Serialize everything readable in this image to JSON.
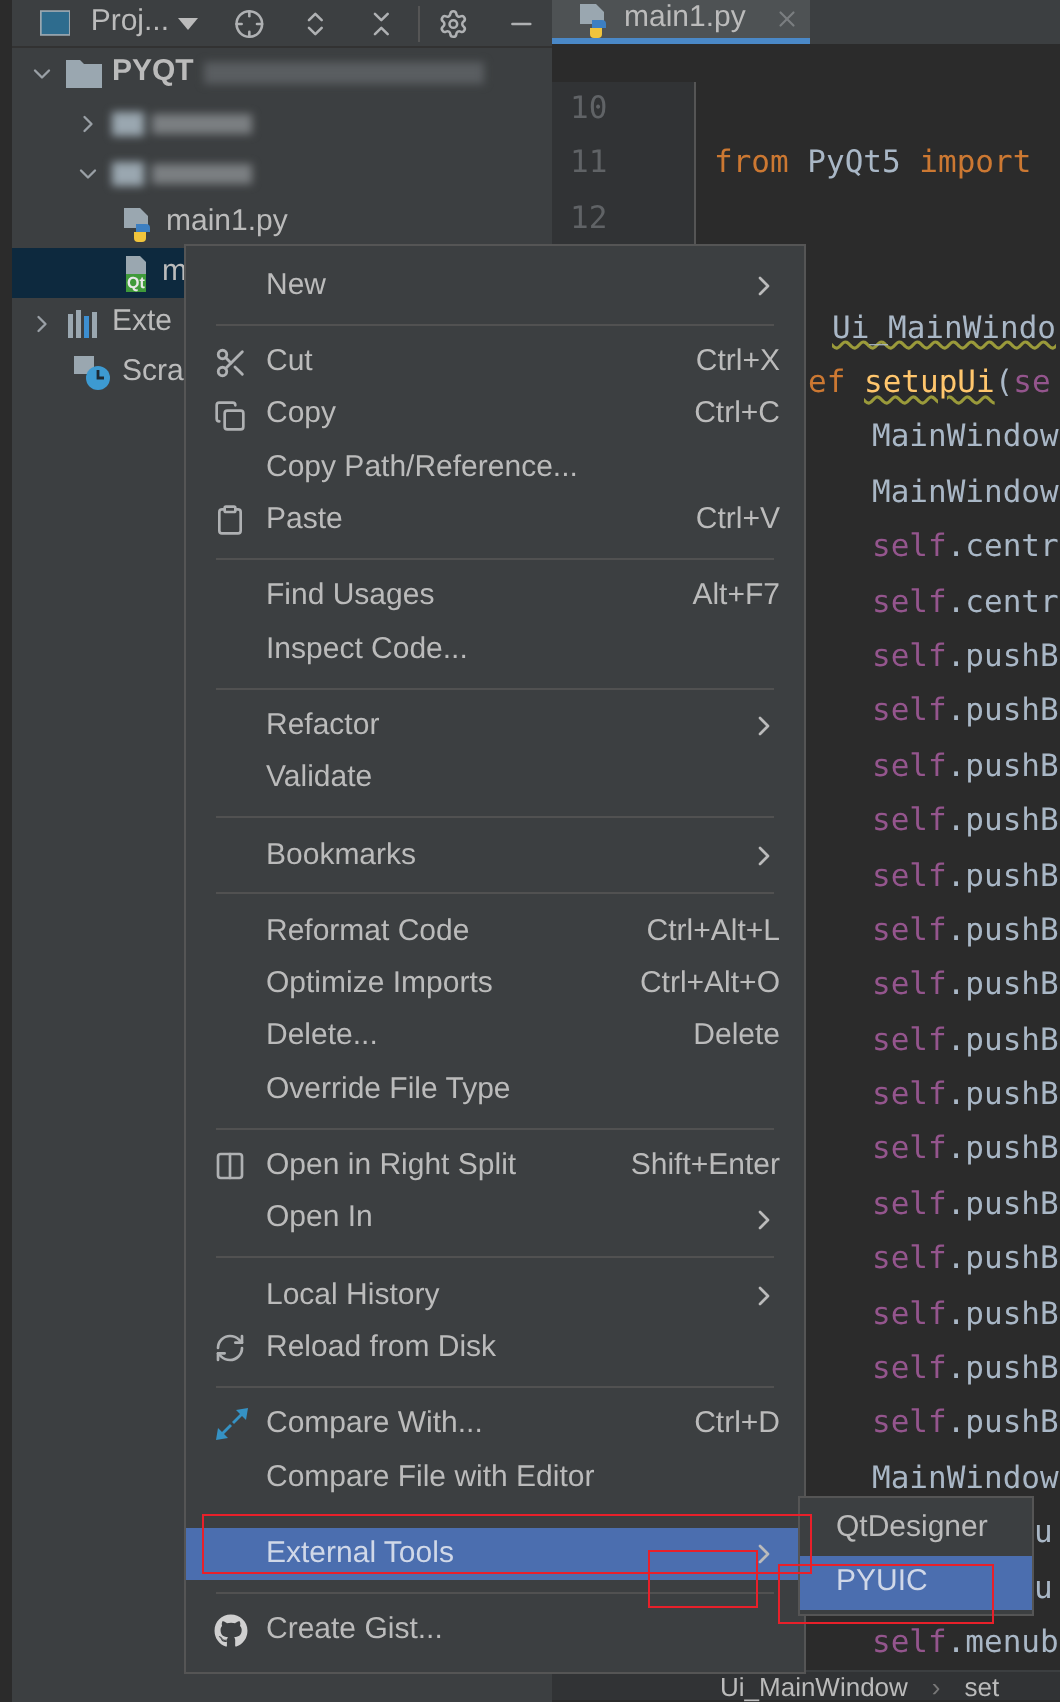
{
  "project_panel": {
    "title": "Proj...",
    "tree": [
      {
        "kind": "project",
        "label": "PYQT",
        "expanded": true,
        "selected": false,
        "children": [
          {
            "kind": "blurred",
            "expanded": false,
            "selected": false
          },
          {
            "kind": "blurred",
            "expanded": true,
            "selected": false,
            "children": [
              {
                "kind": "python",
                "label": "main1.py",
                "selected": false
              },
              {
                "kind": "qt",
                "label": "m",
                "badge": "Qt",
                "selected": true
              }
            ]
          }
        ]
      },
      {
        "kind": "library",
        "label": "Exte",
        "expanded": false,
        "selected": false
      },
      {
        "kind": "scratch",
        "label": "Scra",
        "selected": false
      }
    ]
  },
  "editor": {
    "tab": {
      "label": "main1.py",
      "selected": true
    },
    "gutter_lines": [
      {
        "number": "10"
      },
      {
        "number": "11",
        "tokens": [
          {
            "text": "from ",
            "kind": "keyword"
          },
          {
            "text": "PyQt5 ",
            "kind": "text"
          },
          {
            "text": "import",
            "kind": "keyword"
          }
        ]
      },
      {
        "number": "12"
      }
    ],
    "lines": [
      {
        "kind": "class",
        "tokens": [
          {
            "text": "Ui_MainWindo",
            "kind": "text",
            "underlined": true
          }
        ]
      },
      {
        "kind": "def",
        "tokens": [
          {
            "text": "ef ",
            "kind": "keyword"
          },
          {
            "text": "setupUi",
            "kind": "func",
            "underlined": true
          },
          {
            "text": "(",
            "kind": "text"
          },
          {
            "text": "se",
            "kind": "self"
          }
        ]
      },
      {
        "kind": "body",
        "tokens": [
          {
            "text": "MainWindow",
            "kind": "text"
          }
        ]
      },
      {
        "kind": "body",
        "tokens": [
          {
            "text": "MainWindow",
            "kind": "text"
          }
        ]
      },
      {
        "kind": "body",
        "tokens": [
          {
            "text": "self",
            "kind": "self"
          },
          {
            "text": ".centr",
            "kind": "text"
          }
        ]
      },
      {
        "kind": "body",
        "tokens": [
          {
            "text": "self",
            "kind": "self"
          },
          {
            "text": ".centr",
            "kind": "text"
          }
        ]
      },
      {
        "kind": "body",
        "tokens": [
          {
            "text": "self",
            "kind": "self"
          },
          {
            "text": ".pushB",
            "kind": "text"
          }
        ]
      },
      {
        "kind": "body",
        "tokens": [
          {
            "text": "self",
            "kind": "self"
          },
          {
            "text": ".pushB",
            "kind": "text"
          }
        ]
      },
      {
        "kind": "body",
        "tokens": [
          {
            "text": "self",
            "kind": "self"
          },
          {
            "text": ".pushB",
            "kind": "text"
          }
        ]
      },
      {
        "kind": "body",
        "tokens": [
          {
            "text": "self",
            "kind": "self"
          },
          {
            "text": ".pushB",
            "kind": "text"
          }
        ]
      },
      {
        "kind": "body",
        "tokens": [
          {
            "text": "self",
            "kind": "self"
          },
          {
            "text": ".pushB",
            "kind": "text"
          }
        ]
      },
      {
        "kind": "body",
        "tokens": [
          {
            "text": "self",
            "kind": "self"
          },
          {
            "text": ".pushB",
            "kind": "text"
          }
        ]
      },
      {
        "kind": "body",
        "tokens": [
          {
            "text": "self",
            "kind": "self"
          },
          {
            "text": ".pushB",
            "kind": "text"
          }
        ]
      },
      {
        "kind": "body",
        "tokens": [
          {
            "text": "self",
            "kind": "self"
          },
          {
            "text": ".pushB",
            "kind": "text"
          }
        ]
      },
      {
        "kind": "body",
        "tokens": [
          {
            "text": "self",
            "kind": "self"
          },
          {
            "text": ".pushB",
            "kind": "text"
          }
        ]
      },
      {
        "kind": "body",
        "tokens": [
          {
            "text": "self",
            "kind": "self"
          },
          {
            "text": ".pushB",
            "kind": "text"
          }
        ]
      },
      {
        "kind": "body",
        "tokens": [
          {
            "text": "self",
            "kind": "self"
          },
          {
            "text": ".pushB",
            "kind": "text"
          }
        ]
      },
      {
        "kind": "body",
        "tokens": [
          {
            "text": "self",
            "kind": "self"
          },
          {
            "text": ".pushB",
            "kind": "text"
          }
        ]
      },
      {
        "kind": "body",
        "tokens": [
          {
            "text": "self",
            "kind": "self"
          },
          {
            "text": ".pushB",
            "kind": "text"
          }
        ]
      },
      {
        "kind": "body",
        "tokens": [
          {
            "text": "self",
            "kind": "self"
          },
          {
            "text": ".pushB",
            "kind": "text"
          }
        ]
      },
      {
        "kind": "body",
        "tokens": [
          {
            "text": "self",
            "kind": "self"
          },
          {
            "text": ".pushB",
            "kind": "text"
          }
        ]
      },
      {
        "kind": "body",
        "tokens": [
          {
            "text": "MainWindow",
            "kind": "text"
          }
        ]
      },
      {
        "kind": "tail",
        "tokens": [
          {
            "text": "u",
            "kind": "text"
          }
        ]
      },
      {
        "kind": "tail",
        "tokens": [
          {
            "text": "u",
            "kind": "text"
          }
        ]
      },
      {
        "kind": "body",
        "tokens": [
          {
            "text": "self",
            "kind": "self"
          },
          {
            "text": ".menub",
            "kind": "text"
          }
        ]
      }
    ],
    "breadcrumb": {
      "items": [
        "Ui_MainWindow",
        "set"
      ],
      "separator": "›"
    }
  },
  "context_menu": {
    "items": [
      {
        "kind": "item",
        "label": "New",
        "submenu": true,
        "selected": false
      },
      {
        "kind": "separator"
      },
      {
        "kind": "item",
        "label": "Cut",
        "shortcut": "Ctrl+X",
        "selected": false
      },
      {
        "kind": "item",
        "label": "Copy",
        "shortcut": "Ctrl+C",
        "selected": false
      },
      {
        "kind": "item",
        "label": "Copy Path/Reference...",
        "selected": false
      },
      {
        "kind": "item",
        "label": "Paste",
        "shortcut": "Ctrl+V",
        "selected": false
      },
      {
        "kind": "separator"
      },
      {
        "kind": "item",
        "label": "Find Usages",
        "shortcut": "Alt+F7",
        "selected": false
      },
      {
        "kind": "item",
        "label": "Inspect Code...",
        "selected": false
      },
      {
        "kind": "separator"
      },
      {
        "kind": "item",
        "label": "Refactor",
        "submenu": true,
        "selected": false
      },
      {
        "kind": "item",
        "label": "Validate",
        "selected": false
      },
      {
        "kind": "separator"
      },
      {
        "kind": "item",
        "label": "Bookmarks",
        "submenu": true,
        "selected": false
      },
      {
        "kind": "separator"
      },
      {
        "kind": "item",
        "label": "Reformat Code",
        "shortcut": "Ctrl+Alt+L",
        "selected": false
      },
      {
        "kind": "item",
        "label": "Optimize Imports",
        "shortcut": "Ctrl+Alt+O",
        "selected": false
      },
      {
        "kind": "item",
        "label": "Delete...",
        "shortcut": "Delete",
        "selected": false
      },
      {
        "kind": "item",
        "label": "Override File Type",
        "selected": false
      },
      {
        "kind": "separator"
      },
      {
        "kind": "item",
        "label": "Open in Right Split",
        "shortcut": "Shift+Enter",
        "selected": false
      },
      {
        "kind": "item",
        "label": "Open In",
        "submenu": true,
        "selected": false
      },
      {
        "kind": "separator"
      },
      {
        "kind": "item",
        "label": "Local History",
        "submenu": true,
        "selected": false
      },
      {
        "kind": "item",
        "label": "Reload from Disk",
        "selected": false
      },
      {
        "kind": "separator"
      },
      {
        "kind": "item",
        "label": "Compare With...",
        "shortcut": "Ctrl+D",
        "selected": false
      },
      {
        "kind": "item",
        "label": "Compare File with Editor",
        "selected": false
      },
      {
        "kind": "separator"
      },
      {
        "kind": "item",
        "label": "External Tools",
        "submenu": true,
        "selected": true
      },
      {
        "kind": "separator"
      },
      {
        "kind": "item",
        "label": "Create Gist...",
        "selected": false
      }
    ],
    "submenu": [
      {
        "label": "QtDesigner",
        "selected": false
      },
      {
        "label": "PYUIC",
        "selected": true
      }
    ]
  }
}
